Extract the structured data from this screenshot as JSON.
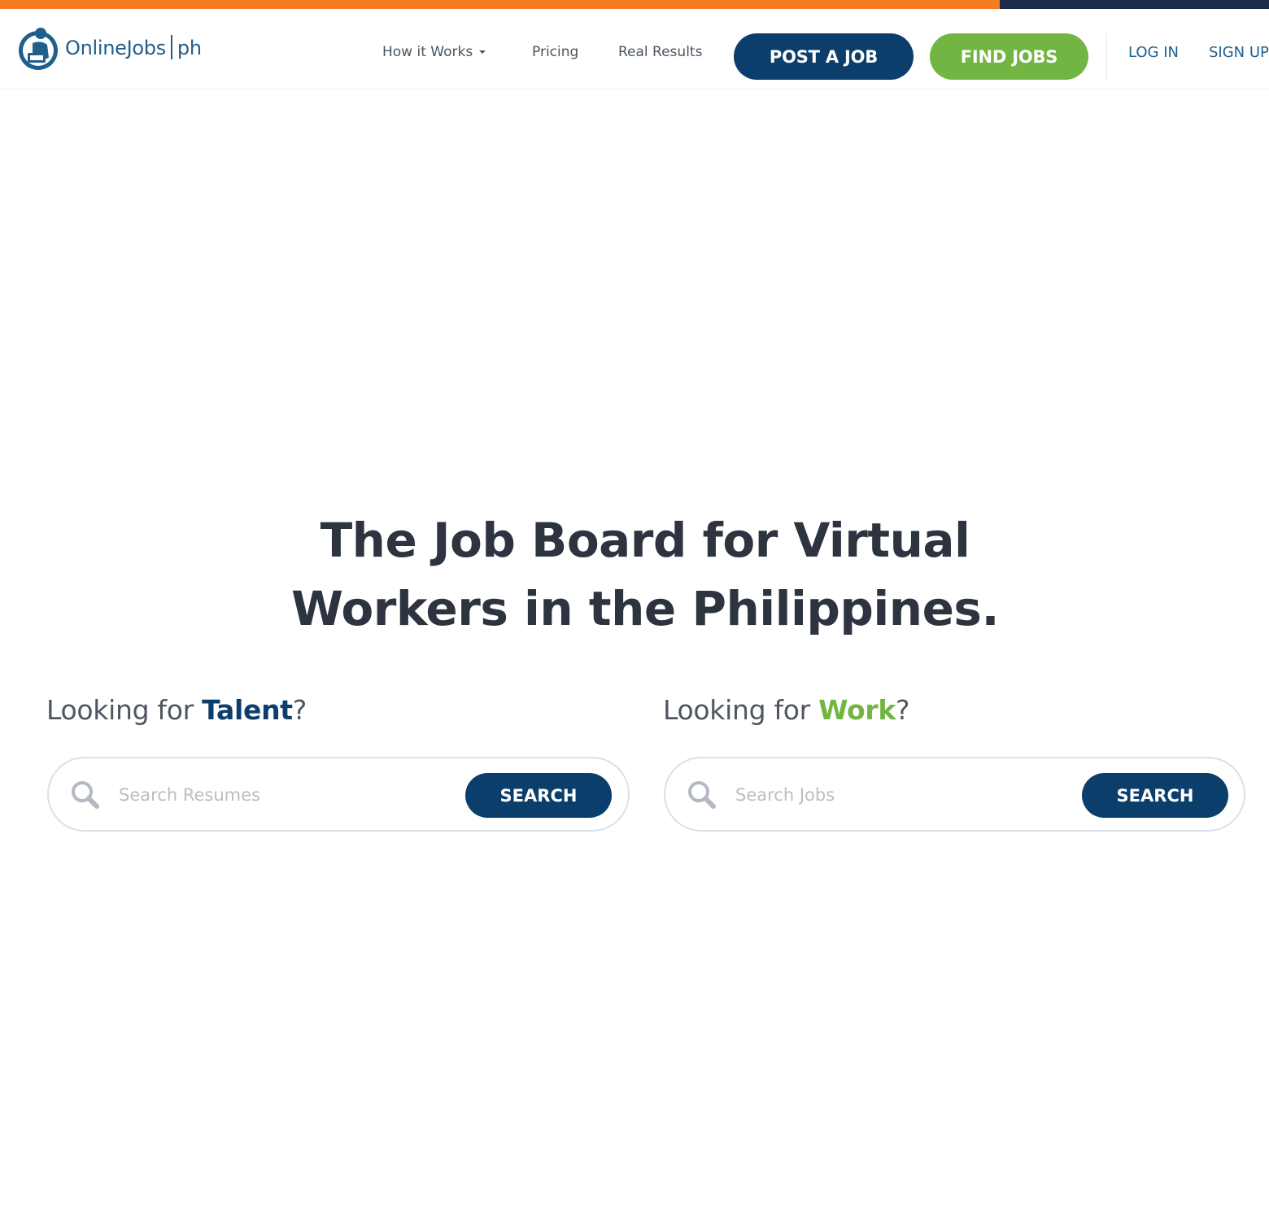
{
  "colors": {
    "top_strip_orange": "#f47b20",
    "top_strip_navy": "#1b2b48",
    "brand_navy": "#0c3e6b",
    "brand_green": "#73b543",
    "heading": "#2d3440"
  },
  "header": {
    "logo": {
      "icon": "person-at-laptop-logo-icon",
      "name": "OnlineJobs",
      "suffix": "ph"
    },
    "nav": {
      "how_it_works": "How it Works",
      "pricing": "Pricing",
      "real_results": "Real Results"
    },
    "post_job": "POST A JOB",
    "find_jobs": "FIND JOBS",
    "login": "LOG IN",
    "signup": "SIGN UP"
  },
  "hero": {
    "title_line1": "The Job Board for Virtual",
    "title_line2": "Workers in the Philippines."
  },
  "talent": {
    "prefix": "Looking for ",
    "emphasis": "Talent",
    "suffix": "?",
    "placeholder": "Search Resumes",
    "button": "SEARCH",
    "icon": "search-icon"
  },
  "work": {
    "prefix": "Looking for ",
    "emphasis": "Work",
    "suffix": "?",
    "placeholder": "Search Jobs",
    "button": "SEARCH",
    "icon": "search-icon"
  }
}
